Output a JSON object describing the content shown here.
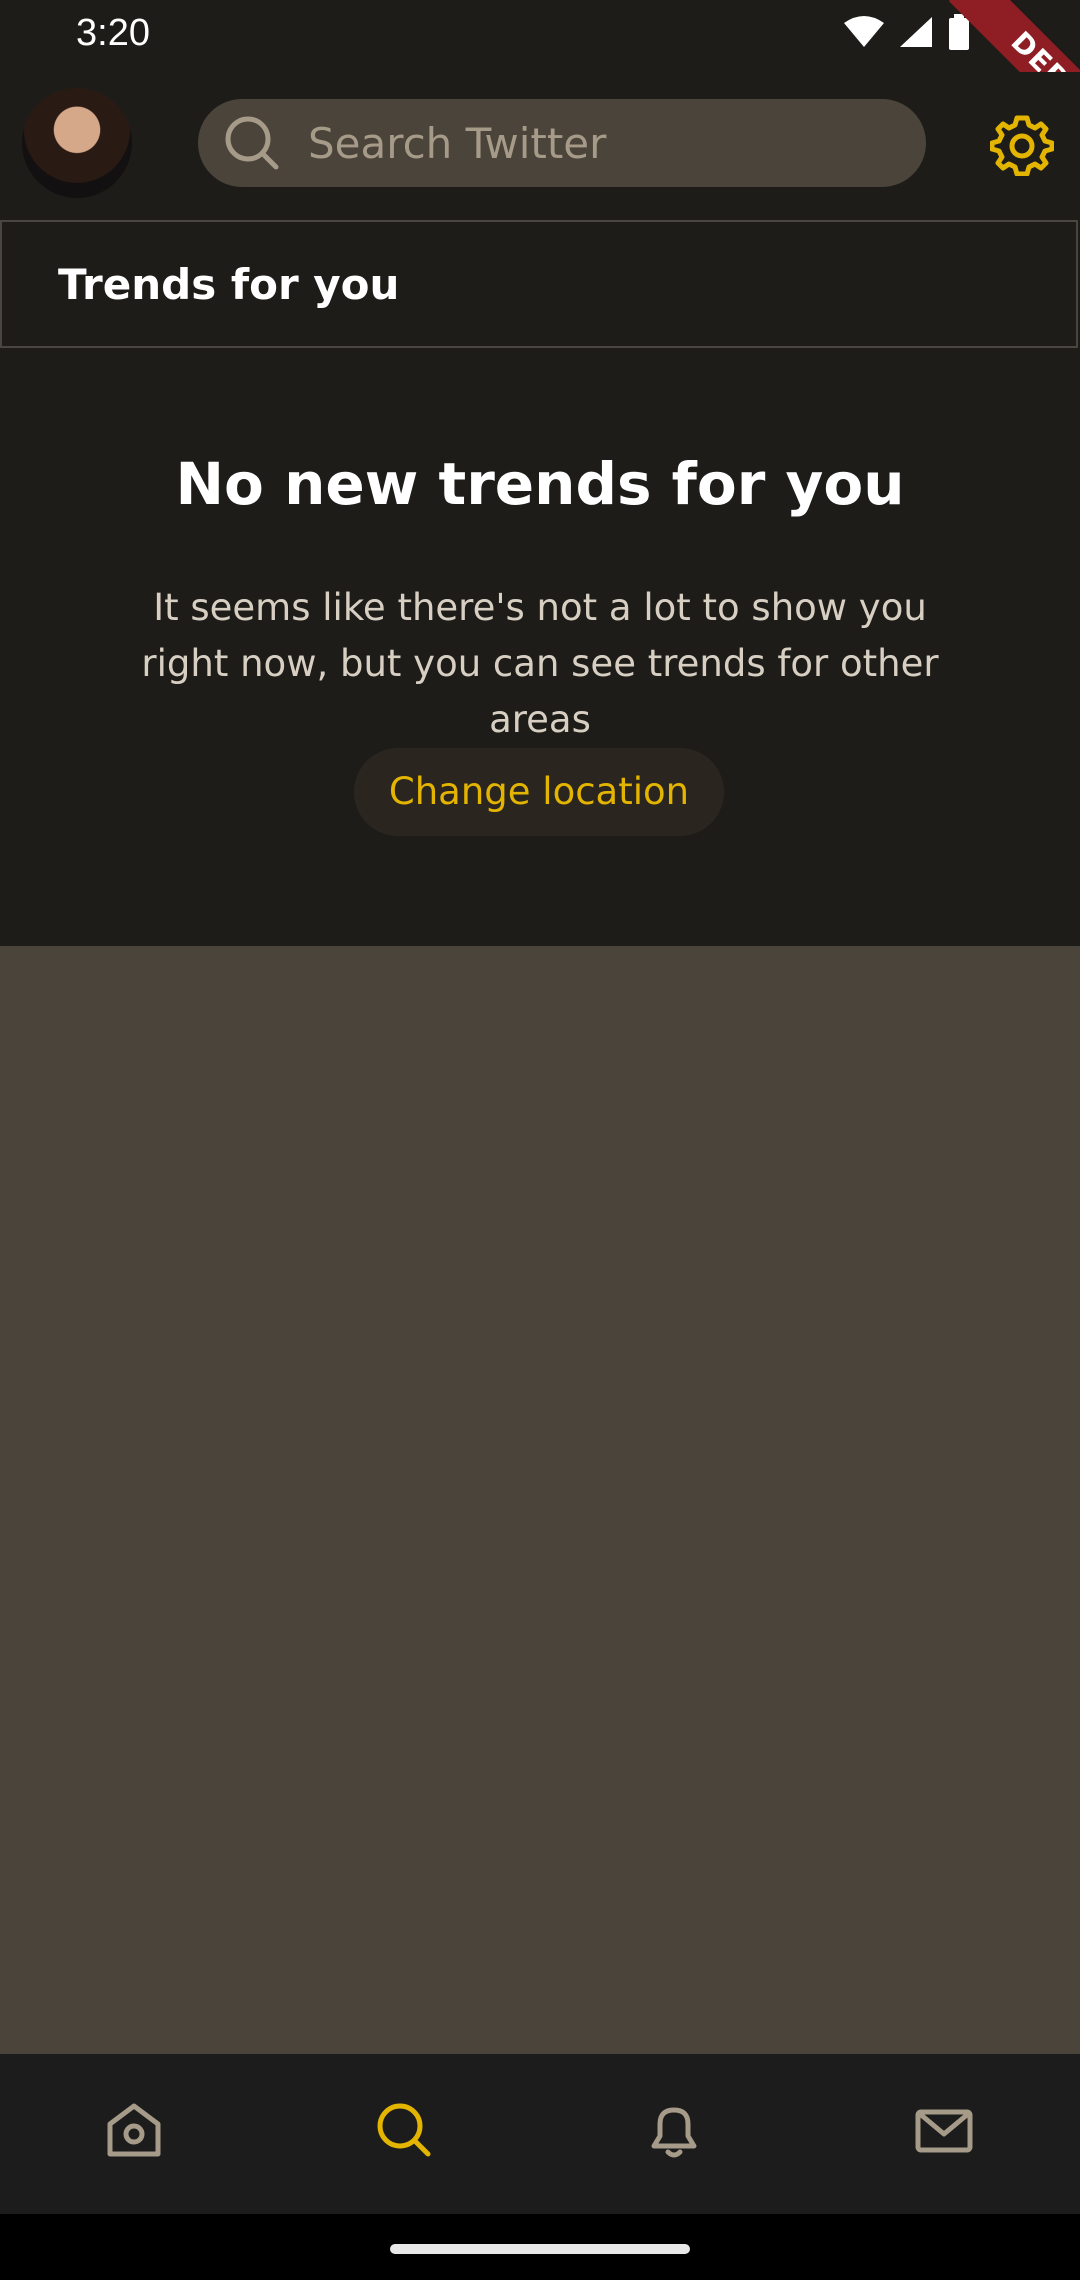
{
  "status_bar": {
    "time": "3:20",
    "debug_label": "DEBUG"
  },
  "app_bar": {
    "search_placeholder": "Search Twitter",
    "accent_color": "#e3b400"
  },
  "trends": {
    "title": "Trends for you"
  },
  "empty_state": {
    "title": "No new trends for you",
    "description": "It seems like there's not a lot to show you right now, but you can see trends for other areas",
    "button_label": "Change location"
  },
  "bottom_nav": {
    "items": [
      {
        "icon": "home-icon",
        "active": false
      },
      {
        "icon": "search-icon",
        "active": true
      },
      {
        "icon": "bell-icon",
        "active": false
      },
      {
        "icon": "mail-icon",
        "active": false
      }
    ]
  }
}
